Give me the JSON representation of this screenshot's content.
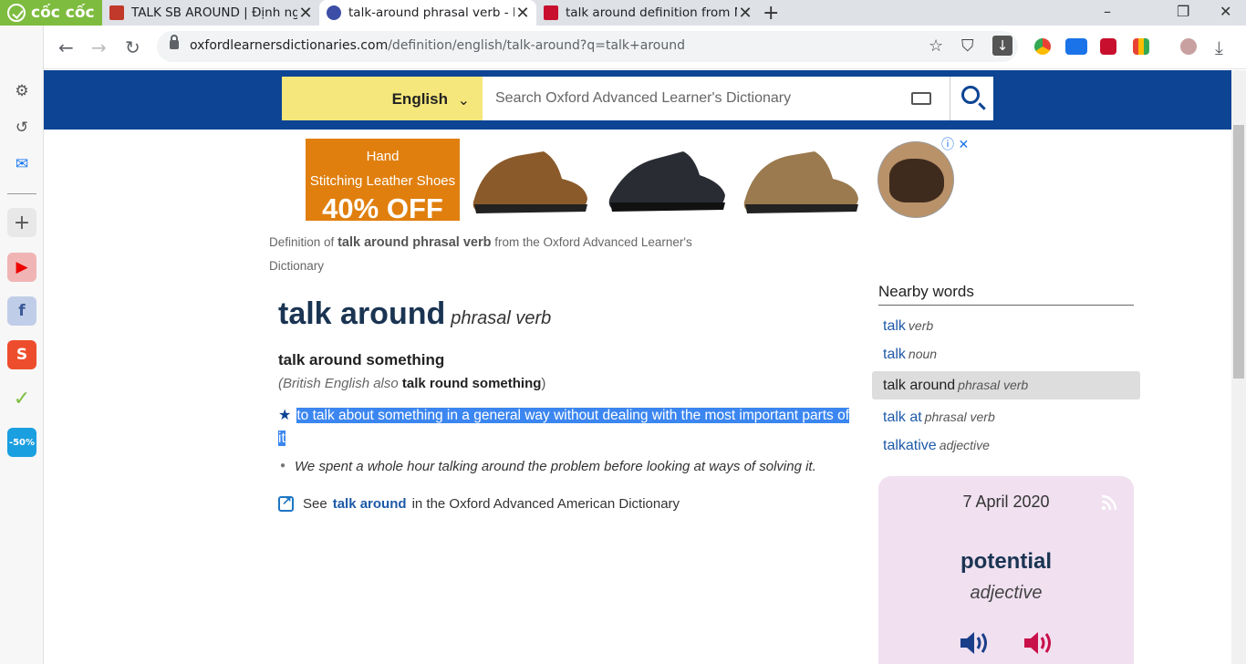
{
  "browser": {
    "brand": "cốc cốc",
    "tabs": [
      {
        "title": "TALK SB AROUND | Định nghĩa",
        "favicon_color": "#c0392b"
      },
      {
        "title": "talk-around phrasal verb - De",
        "favicon_color": "#3d4ea6"
      },
      {
        "title": "talk around definition from M",
        "favicon_color": "#c8102e"
      }
    ],
    "url_domain": "oxfordlearnersdictionaries.com",
    "url_path": "/definition/english/talk-around?q=talk+around"
  },
  "site": {
    "language": "English",
    "search_placeholder": "Search Oxford Advanced Learner's Dictionary",
    "header_color": "#0d4494"
  },
  "ad": {
    "line1": "Hand",
    "line2": "Stitching Leather Shoes",
    "offer": "40% OFF"
  },
  "entry": {
    "source_prefix": "Definition of",
    "source_term": "talk around phrasal verb",
    "source_suffix": "from the Oxford Advanced Learner's Dictionary",
    "headword": "talk around",
    "pos": "phrasal verb",
    "sense_head": "talk around something",
    "variant_open": "(British English also",
    "variant_term": "talk round something",
    "variant_close": ")",
    "definition": "to talk about something in a general way without dealing with the most important parts of it",
    "example": "We spent a whole hour talking around the problem before looking at ways of solving it.",
    "see_prefix": "See",
    "see_link": "talk around",
    "see_suffix": "in the Oxford Advanced American Dictionary"
  },
  "nearby": {
    "title": "Nearby words",
    "items": [
      {
        "word": "talk",
        "pos": "verb"
      },
      {
        "word": "talk",
        "pos": "noun"
      },
      {
        "word": "talk around",
        "pos": "phrasal verb",
        "current": true
      },
      {
        "word": "talk at",
        "pos": "phrasal verb"
      },
      {
        "word": "talkative",
        "pos": "adjective"
      }
    ]
  },
  "word_of_day": {
    "date": "7 April 2020",
    "word": "potential",
    "pos": "adjective"
  }
}
